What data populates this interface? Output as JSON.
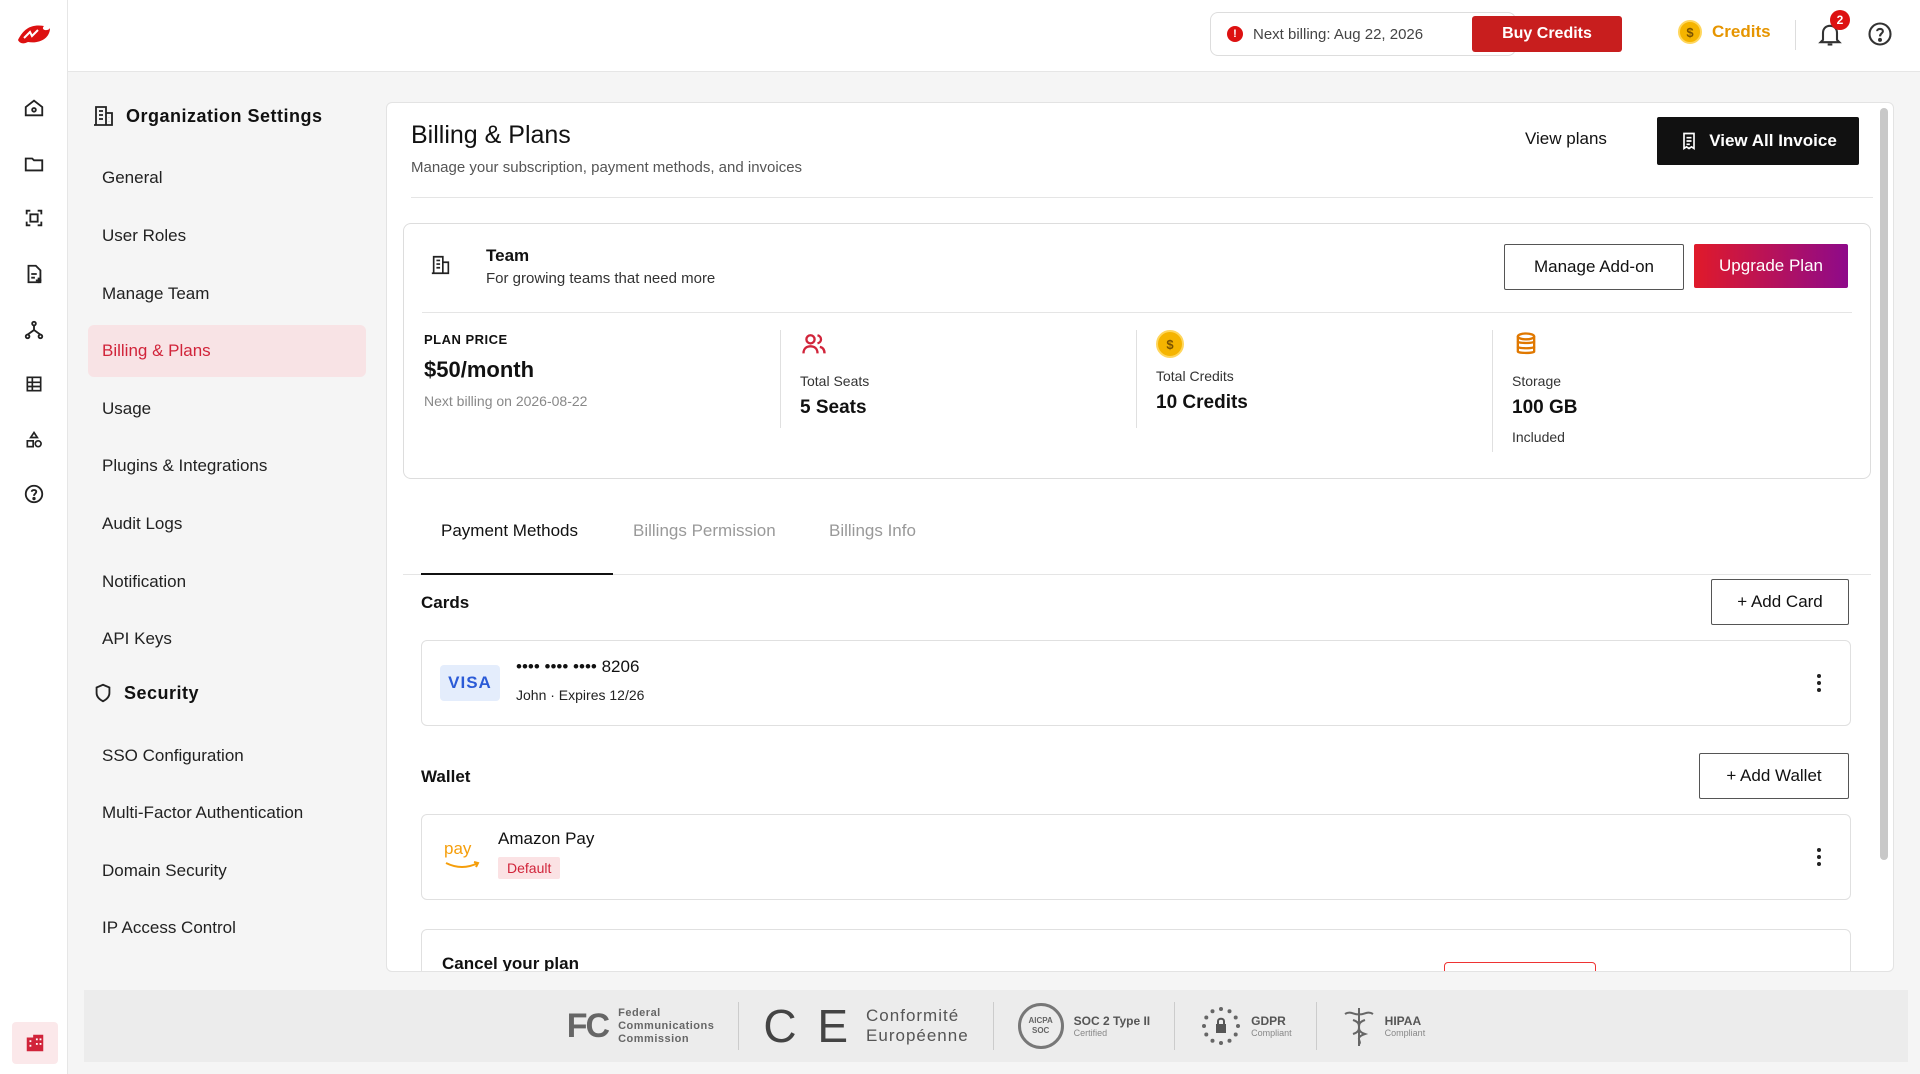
{
  "topbar": {
    "next_billing": "Next billing: Aug 22, 2026",
    "alert_glyph": "!",
    "buy_credits": "Buy Credits",
    "credits_label": "Credits",
    "coin_glyph": "$",
    "notification_count": "2"
  },
  "sidebar": {
    "org_heading": "Organization Settings",
    "org_items": [
      {
        "label": "General"
      },
      {
        "label": "User Roles"
      },
      {
        "label": "Manage Team"
      },
      {
        "label": "Billing & Plans",
        "active": true
      },
      {
        "label": "Usage"
      },
      {
        "label": "Plugins & Integrations"
      },
      {
        "label": "Audit Logs"
      },
      {
        "label": "Notification"
      },
      {
        "label": "API Keys"
      }
    ],
    "security_heading": "Security",
    "security_items": [
      {
        "label": "SSO Configuration"
      },
      {
        "label": "Multi-Factor Authentication"
      },
      {
        "label": "Domain Security"
      },
      {
        "label": "IP Access Control"
      }
    ]
  },
  "rail": {
    "icons": [
      "home-icon",
      "folder-icon",
      "scan-icon",
      "document-add-icon",
      "workflow-icon",
      "table-icon",
      "shapes-icon",
      "help-circle-icon"
    ]
  },
  "page": {
    "title": "Billing & Plans",
    "subtitle": "Manage your subscription, payment methods, and invoices",
    "view_plans": "View plans",
    "view_all_invoice": "View All Invoice"
  },
  "plan": {
    "name": "Team",
    "description": "For growing teams that need more",
    "manage_addon": "Manage Add-on",
    "upgrade": "Upgrade Plan",
    "price_label": "PLAN PRICE",
    "price": "$50/month",
    "next_billing": "Next billing on 2026-08-22",
    "seats_label": "Total Seats",
    "seats_value": "5 Seats",
    "credits_label": "Total Credits",
    "credits_value": "10 Credits",
    "storage_label": "Storage",
    "storage_value": "100 GB",
    "storage_note": "Included"
  },
  "tabs": [
    {
      "label": "Payment Methods",
      "active": true
    },
    {
      "label": "Billings Permission"
    },
    {
      "label": "Billings Info"
    }
  ],
  "payment": {
    "cards_title": "Cards",
    "add_card": "+ Add Card",
    "card": {
      "brand": "VISA",
      "number": "•••• •••• •••• 8206",
      "details": "John · Expires 12/26"
    },
    "wallet_title": "Wallet",
    "add_wallet": "+ Add Wallet",
    "wallet": {
      "logo": "pay",
      "name": "Amazon Pay",
      "badge": "Default"
    },
    "cancel_title": "Cancel your plan"
  },
  "compliance": {
    "fcc_logo": "FC",
    "fcc": [
      "Federal",
      "Communications",
      "Commission"
    ],
    "ce_logo": "C E",
    "ce": [
      "Conformité",
      "Européenne"
    ],
    "soc_logo": "AICPA SOC",
    "soc": {
      "title": "SOC 2 Type II",
      "sub": "Certified"
    },
    "gdpr": {
      "title": "GDPR",
      "sub": "Compliant"
    },
    "hipaa": {
      "title": "HIPAA",
      "sub": "Compliant"
    }
  },
  "colors": {
    "brand_red": "#c81e1e",
    "active_bg": "#f8e3e5",
    "active_text": "#d1243a",
    "credits_gold": "#e69500",
    "upgrade_gradient": [
      "#e01a2a",
      "#8e0a8a"
    ]
  }
}
